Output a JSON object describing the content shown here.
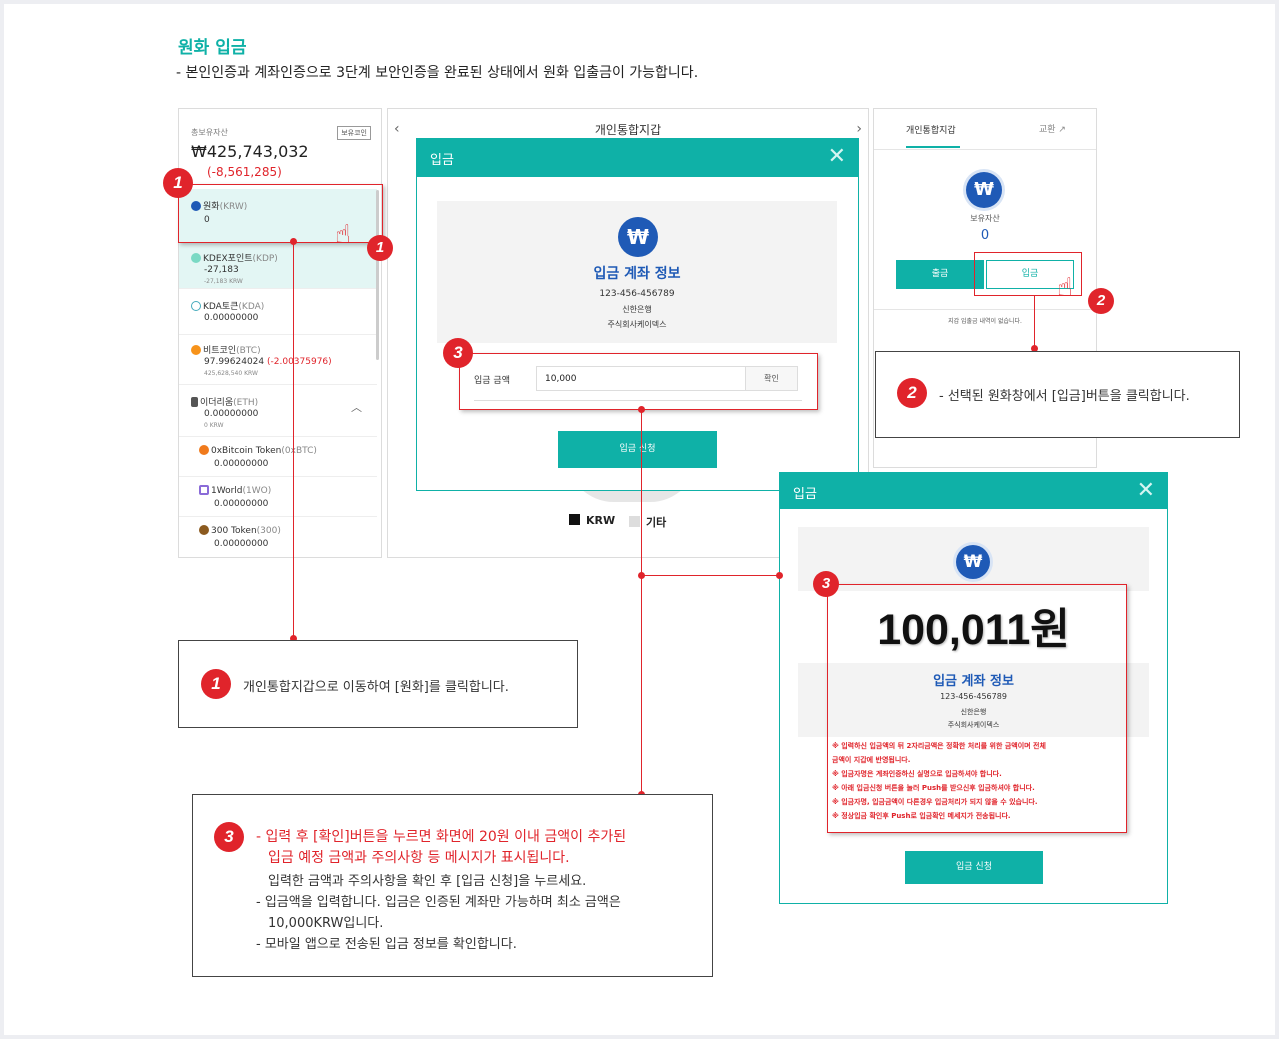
{
  "page": {
    "title": "원화 입금",
    "subtitle": "- 본인인증과 계좌인증으로 3단계 보안인증을 완료된 상태에서 원화 입출금이 가능합니다."
  },
  "left": {
    "total_label": "총보유자산",
    "badge": "보유코인",
    "total_value": "₩425,743,032",
    "total_change": "(-8,561,285)",
    "coins": [
      {
        "name": "원화",
        "code": "(KRW)",
        "v1": "0",
        "v2": ""
      },
      {
        "name": "KDEX포인트",
        "code": "(KDP)",
        "v1": "-27,183",
        "v2": "-27,183 KRW"
      },
      {
        "name": "KDA토큰",
        "code": "(KDA)",
        "v1": "0.00000000",
        "v2": ""
      },
      {
        "name": "비트코인",
        "code": "(BTC)",
        "v1": "97.99624024",
        "chg": "(-2.00375976)",
        "v2": "425,628,540 KRW"
      },
      {
        "name": "이더리움",
        "code": "(ETH)",
        "v1": "0.00000000",
        "v2": "0 KRW"
      },
      {
        "name": "0xBitcoin Token",
        "code": "(0xBTC)",
        "v1": "0.00000000",
        "v2": ""
      },
      {
        "name": "1World",
        "code": "(1WO)",
        "v1": "0.00000000",
        "v2": ""
      },
      {
        "name": "300 Token",
        "code": "(300)",
        "v1": "0.00000000",
        "v2": ""
      }
    ]
  },
  "mid": {
    "title": "개인통합지갑",
    "legend": [
      "KRW",
      "기타"
    ]
  },
  "right": {
    "tab_wallet": "개인통합지갑",
    "tab_exchange": "교환",
    "asset_label": "보유자산",
    "asset_value": "0",
    "withdraw": "출금",
    "deposit": "입금",
    "empty": "지갑 입출금 내역이 없습니다."
  },
  "modal1": {
    "title": "입금",
    "info_title": "입금 계좌 정보",
    "account": "123-456-456789",
    "bank": "신한은행",
    "holder": "주식회사케이덱스",
    "amount_label": "입금 금액",
    "amount_value": "10,000",
    "confirm": "확인",
    "submit": "입금 신청"
  },
  "modal2": {
    "title": "입금",
    "amount": "100,011원",
    "info_title": "입금 계좌 정보",
    "account": "123-456-456789",
    "bank": "신한은행",
    "holder": "주식회사케이덱스",
    "warnings": [
      "※ 입력하신 입금액의 뒤 2자리금액은 정확한 처리를 위한 금액이며 전체",
      "금액이 지갑에 반영됩니다.",
      "※ 입금자명은 계좌인증하신 실명으로 입금하셔야 합니다.",
      "※ 아래 입금신청 버튼을 눌러 Push를 받으신후 입금하셔야 합니다.",
      "※ 입금자명, 입금금액이 다른경우 입금처리가 되지 않을 수 있습니다.",
      "※ 정상입금 확인후 Push로 입금확인 메세지가 전송됩니다."
    ],
    "submit": "입금 신청"
  },
  "callouts": {
    "c1": "개인통합지갑으로 이동하여 [원화]를 클릭합니다.",
    "c2": "- 선택된 원화창에서 [입금]버튼을 클릭합니다.",
    "c3_red1": "- 입력 후 [확인]버튼을 누르면 화면에 20원 이내 금액이 추가된",
    "c3_red2": "입금 예정 금액과 주의사항 등 메시지가 표시됩니다.",
    "c3_l1": "입력한 금액과 주의사항을 확인 후 [입금 신청]을 누르세요.",
    "c3_l2": "- 입금액을 입력합니다. 입금은 인증된 계좌만 가능하며 최소 금액은",
    "c3_l3": "10,000KRW입니다.",
    "c3_l4": "- 모바일 앱으로 전송된 입금 정보를 확인합니다."
  },
  "steps": [
    "1",
    "2",
    "3"
  ],
  "icons": {
    "won": "won-coin-icon",
    "hand": "pointing-hand-icon",
    "close": "close-icon",
    "prev": "chevron-left-icon",
    "next": "chevron-right-icon",
    "external": "external-link-icon",
    "collapse": "chevron-up-icon"
  },
  "colors": {
    "accent": "#0fb1a7",
    "highlight": "#e0242b",
    "brand_coin": "#1f5ab6"
  }
}
